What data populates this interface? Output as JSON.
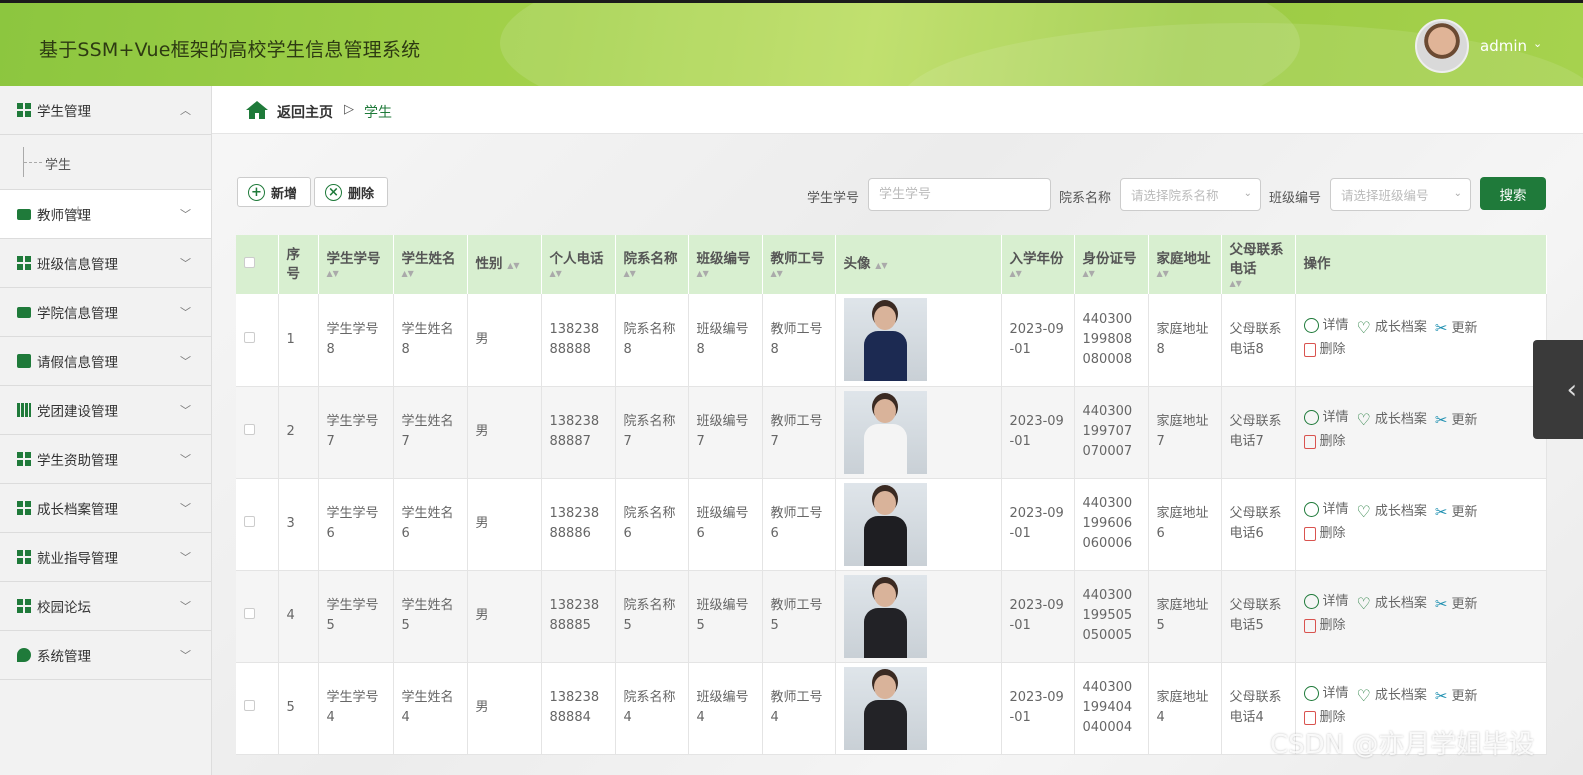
{
  "header": {
    "title": "基于SSM+Vue框架的高校学生信息管理系统",
    "user_name": "admin"
  },
  "sidebar": {
    "items": [
      {
        "label": "学生管理",
        "icon": "grid-icon",
        "expanded": true,
        "children": [
          "学生"
        ]
      },
      {
        "label": "教师管理",
        "icon": "monitor-icon"
      },
      {
        "label": "班级信息管理",
        "icon": "grid-icon"
      },
      {
        "label": "学院信息管理",
        "icon": "book-icon"
      },
      {
        "label": "请假信息管理",
        "icon": "clipboard-icon"
      },
      {
        "label": "党团建设管理",
        "icon": "bar-icon"
      },
      {
        "label": "学生资助管理",
        "icon": "grid-icon"
      },
      {
        "label": "成长档案管理",
        "icon": "grid-icon"
      },
      {
        "label": "就业指导管理",
        "icon": "grid-icon"
      },
      {
        "label": "校园论坛",
        "icon": "grid-icon"
      },
      {
        "label": "系统管理",
        "icon": "leaf-icon"
      }
    ]
  },
  "breadcrumb": {
    "home": "返回主页",
    "separator": "▷",
    "current": "学生"
  },
  "toolbar": {
    "add_label": "新增",
    "delete_label": "删除"
  },
  "search": {
    "student_no_label": "学生学号",
    "student_no_placeholder": "学生学号",
    "dept_label": "院系名称",
    "dept_placeholder": "请选择院系名称",
    "class_label": "班级编号",
    "class_placeholder": "请选择班级编号",
    "button_label": "搜索"
  },
  "table": {
    "headers": [
      "序号",
      "学生学号",
      "学生姓名",
      "性别",
      "个人电话",
      "院系名称",
      "班级编号",
      "教师工号",
      "头像",
      "入学年份",
      "身份证号",
      "家庭地址",
      "父母联系电话",
      "操作"
    ],
    "rows": [
      {
        "idx": "1",
        "no": "学生学号8",
        "name": "学生姓名8",
        "gender": "男",
        "phone": "13823888888",
        "dept": "院系名称8",
        "cls": "班级编号8",
        "teacher": "教师工号8",
        "year": "2023-09-01",
        "id": "440300199808080008",
        "addr": "家庭地址8",
        "parent": "父母联系电话8",
        "outfit": "#1c2a52"
      },
      {
        "idx": "2",
        "no": "学生学号7",
        "name": "学生姓名7",
        "gender": "男",
        "phone": "13823888887",
        "dept": "院系名称7",
        "cls": "班级编号7",
        "teacher": "教师工号7",
        "year": "2023-09-01",
        "id": "440300199707070007",
        "addr": "家庭地址7",
        "parent": "父母联系电话7",
        "outfit": "#f4f4f4"
      },
      {
        "idx": "3",
        "no": "学生学号6",
        "name": "学生姓名6",
        "gender": "男",
        "phone": "13823888886",
        "dept": "院系名称6",
        "cls": "班级编号6",
        "teacher": "教师工号6",
        "year": "2023-09-01",
        "id": "440300199606060006",
        "addr": "家庭地址6",
        "parent": "父母联系电话6",
        "outfit": "#1e1e22"
      },
      {
        "idx": "4",
        "no": "学生学号5",
        "name": "学生姓名5",
        "gender": "男",
        "phone": "13823888885",
        "dept": "院系名称5",
        "cls": "班级编号5",
        "teacher": "教师工号5",
        "year": "2023-09-01",
        "id": "440300199505050005",
        "addr": "家庭地址5",
        "parent": "父母联系电话5",
        "outfit": "#222226"
      },
      {
        "idx": "5",
        "no": "学生学号4",
        "name": "学生姓名4",
        "gender": "男",
        "phone": "13823888884",
        "dept": "院系名称4",
        "cls": "班级编号4",
        "teacher": "教师工号4",
        "year": "2023-09-01",
        "id": "440300199404040004",
        "addr": "家庭地址4",
        "parent": "父母联系电话4",
        "outfit": "#232327"
      }
    ],
    "actions": {
      "detail": "详情",
      "archive": "成长档案",
      "update": "更新",
      "delete": "删除"
    }
  },
  "watermark": "CSDN @亦月学姐毕设",
  "colors": {
    "accent": "#1f7a3a",
    "header": "#9ccb43",
    "table_header": "#d8efd0"
  }
}
